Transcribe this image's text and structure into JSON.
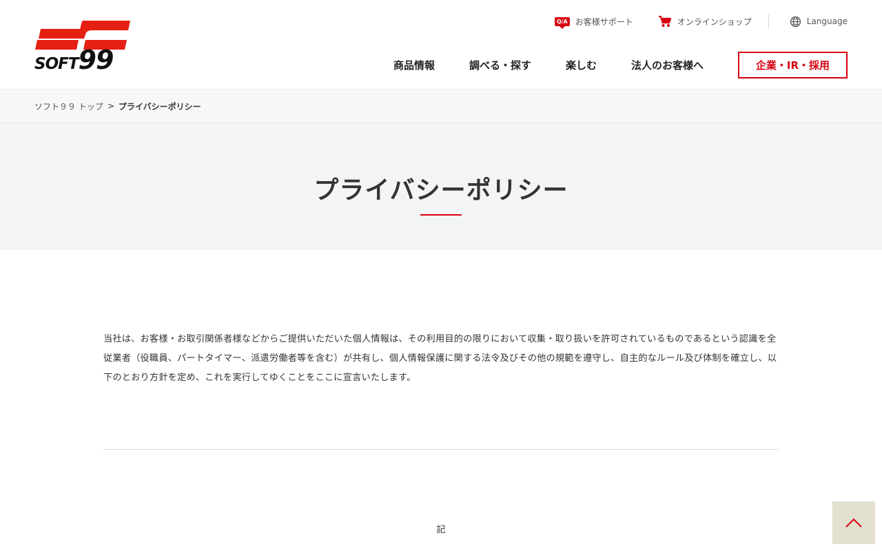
{
  "header": {
    "logo": {
      "text_prefix": "SOFT",
      "text_number": "99",
      "brand_color": "#e51f12"
    },
    "utility": {
      "support_badge": "Q/A",
      "support_label": "お客様サポート",
      "shop_label": "オンラインショップ",
      "language_label": "Language"
    },
    "nav": {
      "items": [
        "商品情報",
        "調べる・探す",
        "楽しむ",
        "法人のお客様へ"
      ],
      "cta_label": "企業・IR・採用"
    }
  },
  "breadcrumb": {
    "home": "ソフト９９ トップ",
    "separator": ">",
    "current": "プライバシーポリシー"
  },
  "hero": {
    "title": "プライバシーポリシー"
  },
  "content": {
    "intro": "当社は、お客様・お取引関係者様などからご提供いただいた個人情報は、その利用目的の限りにおいて収集・取り扱いを許可されているものであるという認識を全従業者（役職員、パートタイマー、派遣労働者等を含む）が共有し、個人情報保護に関する法令及びその他の規範を遵守し、自主的なルール及び体制を確立し、以下のとおり方針を定め、これを実行してゆくことをここに宣言いたします。",
    "ki": "記"
  },
  "colors": {
    "accent": "#d7000f",
    "hero_bg": "#f3f4f5",
    "pagetop_bg": "#e4e0cf"
  },
  "icons": {
    "support": "qa-bubble-icon",
    "shop": "cart-icon",
    "language": "globe-icon",
    "pagetop": "chevron-up-icon"
  }
}
